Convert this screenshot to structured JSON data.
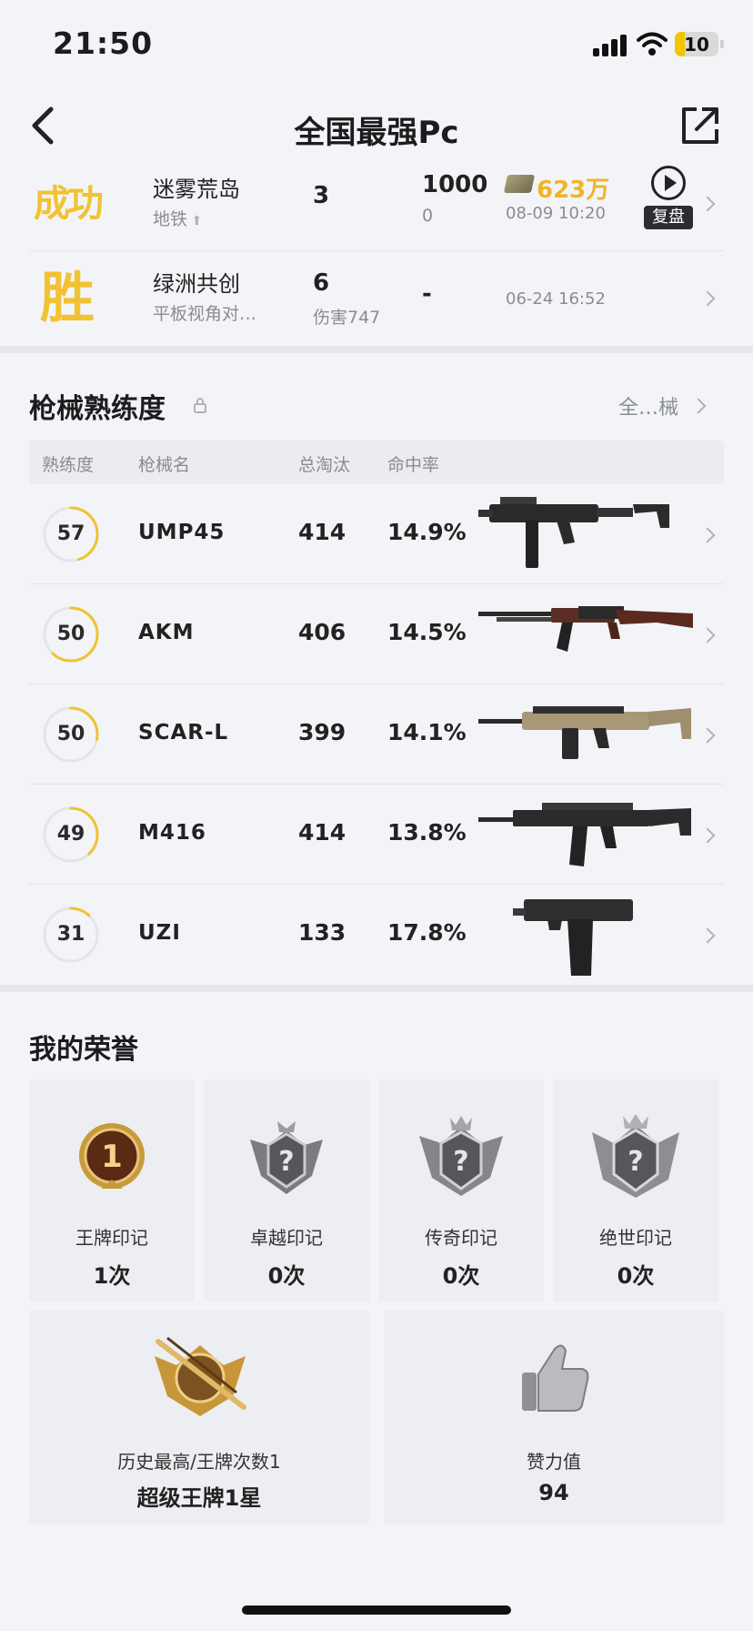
{
  "status_bar": {
    "time": "21:50",
    "battery": "10"
  },
  "header": {
    "title": "全国最强Pc"
  },
  "matches": [
    {
      "result": "成功",
      "map": "迷雾荒岛",
      "mode": "地铁",
      "rank": "3",
      "sub": "",
      "score": "1000",
      "score_sub": "0",
      "money": "623万",
      "date": "08-09 10:20",
      "replay_label": "复盘"
    },
    {
      "result": "胜",
      "map": "绿洲共创",
      "mode": "平板视角对…",
      "rank": "6",
      "sub": "伤害747",
      "score": "-",
      "score_sub": "",
      "money": "",
      "date": "06-24 16:52"
    }
  ],
  "weapons": {
    "title": "枪械熟练度",
    "all_link": "全…械",
    "columns": [
      "熟练度",
      "枪械名",
      "总淘汰",
      "命中率"
    ],
    "rows": [
      {
        "level": "57",
        "name": "UMP45",
        "kills": "414",
        "accuracy": "14.9%",
        "progress": 0.45
      },
      {
        "level": "50",
        "name": "AKM",
        "kills": "406",
        "accuracy": "14.5%",
        "progress": 0.62
      },
      {
        "level": "50",
        "name": "SCAR-L",
        "kills": "399",
        "accuracy": "14.1%",
        "progress": 0.28
      },
      {
        "level": "49",
        "name": "M416",
        "kills": "414",
        "accuracy": "13.8%",
        "progress": 0.38
      },
      {
        "level": "31",
        "name": "UZI",
        "kills": "133",
        "accuracy": "17.8%",
        "progress": 0.12
      }
    ]
  },
  "honors": {
    "title": "我的荣誉",
    "items": [
      {
        "label": "王牌印记",
        "count": "1次",
        "icon": "ace-medal-icon"
      },
      {
        "label": "卓越印记",
        "count": "0次",
        "icon": "locked-badge-icon"
      },
      {
        "label": "传奇印记",
        "count": "0次",
        "icon": "locked-badge-icon"
      },
      {
        "label": "绝世印记",
        "count": "0次",
        "icon": "locked-badge-icon"
      }
    ],
    "tier": {
      "label": "历史最高/王牌次数1",
      "value": "超级王牌1星"
    },
    "likes": {
      "label": "赞力值",
      "value": "94"
    }
  },
  "colors": {
    "accent": "#f1c232",
    "ring_track": "#e4e5e8",
    "background": "#f3f4f7"
  }
}
